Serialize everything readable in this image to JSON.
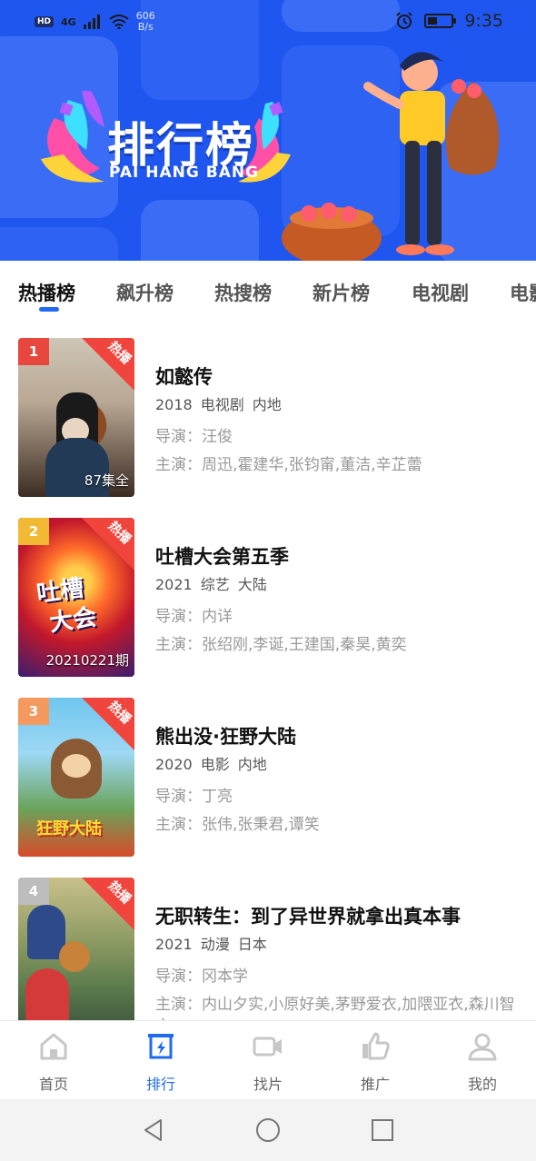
{
  "status_bar": {
    "badge": "HD",
    "network": "4G",
    "speed_value": "606",
    "speed_unit": "B/s",
    "time": "9:35"
  },
  "banner": {
    "title": "排行榜",
    "subtitle": "PAI HANG BANG"
  },
  "tabs": [
    {
      "label": "热播榜",
      "active": true
    },
    {
      "label": "飙升榜",
      "active": false
    },
    {
      "label": "热搜榜",
      "active": false
    },
    {
      "label": "新片榜",
      "active": false
    },
    {
      "label": "电视剧",
      "active": false
    },
    {
      "label": "电影",
      "active": false
    }
  ],
  "ranking": [
    {
      "rank": "1",
      "rank_color": "#e8473e",
      "badge": "热播",
      "episodes": "87集全",
      "title": "如懿传",
      "year": "2018",
      "category": "电视剧",
      "region": "内地",
      "director": "导演：汪俊",
      "cast": "主演：周迅,霍建华,张钧甯,董洁,辛芷蕾"
    },
    {
      "rank": "2",
      "rank_color": "#f2b934",
      "badge": "热播",
      "episodes": "20210221期",
      "title": "吐槽大会第五季",
      "year": "2021",
      "category": "综艺",
      "region": "大陆",
      "director": "导演：内详",
      "cast": "主演：张绍刚,李诞,王建国,秦昊,黄奕"
    },
    {
      "rank": "3",
      "rank_color": "#f49a5e",
      "badge": "热播",
      "episodes": "",
      "title": "熊出没·狂野大陆",
      "year": "2020",
      "category": "电影",
      "region": "内地",
      "director": "导演：丁亮",
      "cast": "主演：张伟,张秉君,谭笑"
    },
    {
      "rank": "4",
      "rank_color": "#bdbdbd",
      "badge": "热播",
      "episodes": "",
      "title": "无职转生：到了异世界就拿出真本事",
      "year": "2021",
      "category": "动漫",
      "region": "日本",
      "director": "导演：冈本学",
      "cast": "主演：内山夕实,小原好美,茅野爱衣,加隈亚衣,森川智之"
    }
  ],
  "bottom_nav": [
    {
      "label": "首页",
      "icon": "home-icon",
      "active": false
    },
    {
      "label": "排行",
      "icon": "ranking-icon",
      "active": true
    },
    {
      "label": "找片",
      "icon": "video-camera-icon",
      "active": false
    },
    {
      "label": "推广",
      "icon": "thumbs-up-icon",
      "active": false
    },
    {
      "label": "我的",
      "icon": "user-icon",
      "active": false
    }
  ],
  "colors": {
    "banner_blue": "#1f56f0",
    "accent": "#1f6af0",
    "badge_red": "#f0453c"
  }
}
